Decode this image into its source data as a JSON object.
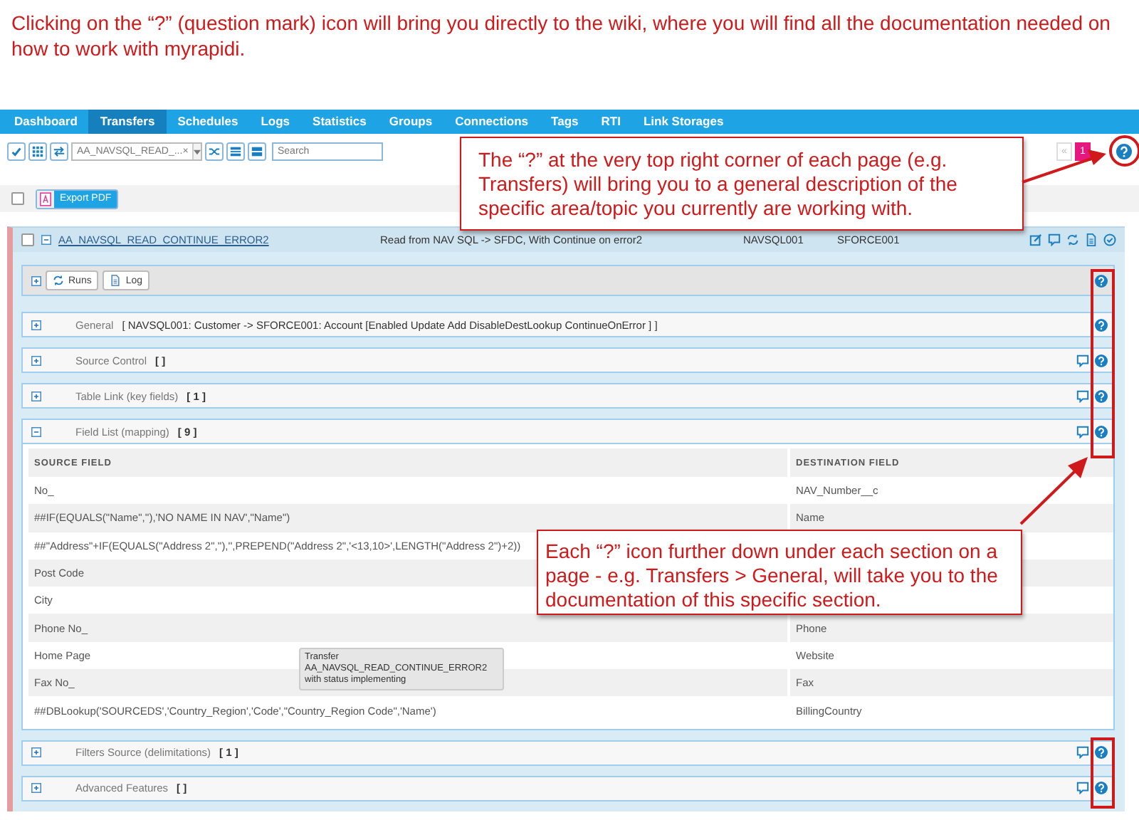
{
  "instruction": "Clicking on the “?” (question mark) icon will bring you directly to the wiki, where you will find all the documentation needed on how to work with myrapidi.",
  "nav": [
    {
      "label": "Dashboard",
      "selected": false
    },
    {
      "label": "Transfers",
      "selected": true
    },
    {
      "label": "Schedules",
      "selected": false
    },
    {
      "label": "Logs",
      "selected": false
    },
    {
      "label": "Statistics",
      "selected": false
    },
    {
      "label": "Groups",
      "selected": false
    },
    {
      "label": "Connections",
      "selected": false
    },
    {
      "label": "Tags",
      "selected": false
    },
    {
      "label": "RTI",
      "selected": false
    },
    {
      "label": "Link Storages",
      "selected": false
    }
  ],
  "toolbar": {
    "filter_value": "AA_NAVSQL_READ_...",
    "clear": "×",
    "search": {
      "placeholder": "Search"
    },
    "pager": [
      {
        "label": "«",
        "selected": false
      },
      {
        "label": "1",
        "selected": true
      }
    ]
  },
  "list_bar": {
    "checked": false,
    "export_button": "Export PDF"
  },
  "transfer": {
    "checked": false,
    "expanded": true,
    "name": "AA_NAVSQL_READ_CONTINUE_ERROR2",
    "description": "Read from NAV SQL -> SFDC, With Continue on error2",
    "source": "NAVSQL001",
    "destination": "SFORCE001"
  },
  "actions": {
    "expanded": false,
    "buttons": [
      "Runs",
      "Log"
    ]
  },
  "sections": [
    {
      "title": "General",
      "summary": "[ NAVSQL001: Customer -> SFORCE001: Account [Enabled Update Add DisableDestLookup ContinueOnError ] ]",
      "expanded": false,
      "comment_icon": false
    },
    {
      "title": "Source Control",
      "summary": "[ ]",
      "expanded": false,
      "comment_icon": true
    },
    {
      "title": "Table Link (key fields)",
      "summary": "[ 1 ]",
      "expanded": false,
      "comment_icon": true
    },
    {
      "title": "Field List (mapping)",
      "summary": "[ 9 ]",
      "expanded": true,
      "comment_icon": true,
      "table": {
        "columns": [
          "SOURCE FIELD",
          "DESTINATION FIELD"
        ],
        "rows": [
          {
            "source": "No_",
            "destination": "NAV_Number__c"
          },
          {
            "source": "##IF(EQUALS(\"Name\",''),'NO NAME IN NAV',\"Name\")",
            "destination": "Name"
          },
          {
            "source": "##\"Address\"+IF(EQUALS(\"Address 2\",''),'',PREPEND(\"Address 2\",'<13,10>',LENGTH(\"Address 2\")+2))"
          },
          {
            "source": "Post Code"
          },
          {
            "source": "City"
          },
          {
            "source": "Phone No_",
            "destination": "Phone"
          },
          {
            "source": "Home Page",
            "destination": "Website"
          },
          {
            "source": "Fax No_",
            "destination": "Fax"
          },
          {
            "source": "##DBLookup('SOURCEDS','Country_Region','Code',\"Country_Region Code\",'Name')",
            "destination": "BillingCountry"
          }
        ]
      }
    },
    {
      "title": "Filters Source (delimitations)",
      "summary": "[ 1 ]",
      "expanded": false,
      "comment_icon": true
    },
    {
      "title": "Advanced Features",
      "summary": "[ ]",
      "expanded": false,
      "comment_icon": true
    }
  ],
  "tooltip": "Transfer AA_NAVSQL_READ_CONTINUE_ERROR2 with status implementing",
  "callouts": [
    {
      "text": "The “?” at the very top right corner of each page (e.g. Transfers) will bring you to a general description of the specific area/topic you currently are working with."
    },
    {
      "text": "Each “?” icon further down under each section on a page - e.g. Transfers > General, will take you to the documentation of this specific section."
    }
  ]
}
